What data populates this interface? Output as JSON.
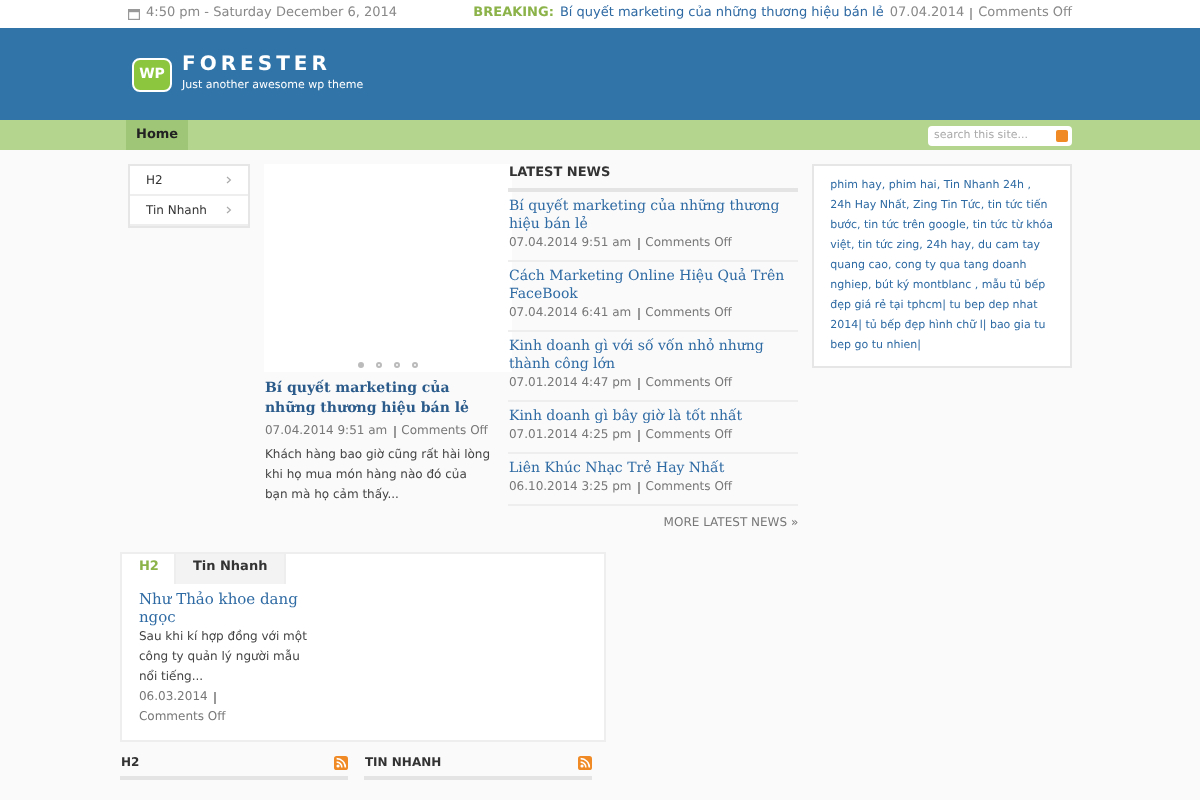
{
  "top_bar": {
    "datetime": "4:50 pm - Saturday December 6, 2014",
    "breaking_label": "BREAKING:",
    "breaking_title": "Bí quyết marketing của những thương hiệu bán lẻ",
    "breaking_date": "07.04.2014",
    "breaking_comments": "Comments Off"
  },
  "header": {
    "logo_badge": "WP",
    "site_name": "FORESTER",
    "tagline": "Just another awesome wp theme"
  },
  "nav": {
    "items": [
      {
        "label": "Home",
        "selected": true
      }
    ],
    "search": {
      "placeholder": "search this site..."
    }
  },
  "sidebar_menu": [
    {
      "label": "H2"
    },
    {
      "label": "Tin Nhanh"
    }
  ],
  "slider": {
    "dots": [
      {
        "selected": true
      },
      {
        "selected": false
      },
      {
        "selected": false
      },
      {
        "selected": false
      }
    ],
    "title": "Bí quyết marketing của những thương hiệu bán lẻ",
    "date": "07.04.2014 9:51 am",
    "comments": "Comments Off",
    "excerpt": "Khách hàng bao giờ cũng rất hài lòng khi họ mua món hàng nào đó của bạn mà họ cảm thấy..."
  },
  "latest_news": {
    "heading": "LATEST NEWS",
    "items": [
      {
        "title": "Bí quyết marketing của những thương hiệu bán lẻ",
        "date": "07.04.2014 9:51 am",
        "comments": "Comments Off"
      },
      {
        "title": "Cách Marketing Online Hiệu Quả Trên FaceBook",
        "date": "07.04.2014 6:41 am",
        "comments": "Comments Off"
      },
      {
        "title": "Kinh doanh gì với số vốn nhỏ nhưng thành công lớn",
        "date": "07.01.2014 4:47 pm",
        "comments": "Comments Off"
      },
      {
        "title": "Kinh doanh gì bây giờ là tốt nhất",
        "date": "07.01.2014 4:25 pm",
        "comments": "Comments Off"
      },
      {
        "title": "Liên Khúc Nhạc Trẻ Hay Nhất",
        "date": "06.10.2014 3:25 pm",
        "comments": "Comments Off"
      }
    ],
    "more": "MORE LATEST NEWS »"
  },
  "text_widget": "phim hay, phim hai, Tin Nhanh 24h , 24h Hay Nhất, Zing Tin Tức, tin tức tiến bước, tin tức trên google, tin tức từ khóa việt, tin tức zing, 24h hay, du cam tay quang cao, cong ty qua tang doanh nghiep, bút ký montblanc , mẫu tủ bếp đẹp giá rẻ tại tphcm| tu bep dep nhat 2014| tủ bếp đẹp hình chữ l| bao gia tu bep go tu nhien|",
  "tabs_widget": {
    "tabs": [
      {
        "label": "H2",
        "selected": true
      },
      {
        "label": "Tin Nhanh",
        "selected": false
      }
    ],
    "post": {
      "title": "Như Thảo khoe dang ngọc",
      "excerpt": "Sau khi kí hợp đồng với một công ty quản lý người mẫu nổi tiếng...",
      "date": "06.03.2014",
      "comments": "Comments Off"
    }
  },
  "category_headings": [
    {
      "label": "H2"
    },
    {
      "label": "TIN NHANH"
    }
  ]
}
